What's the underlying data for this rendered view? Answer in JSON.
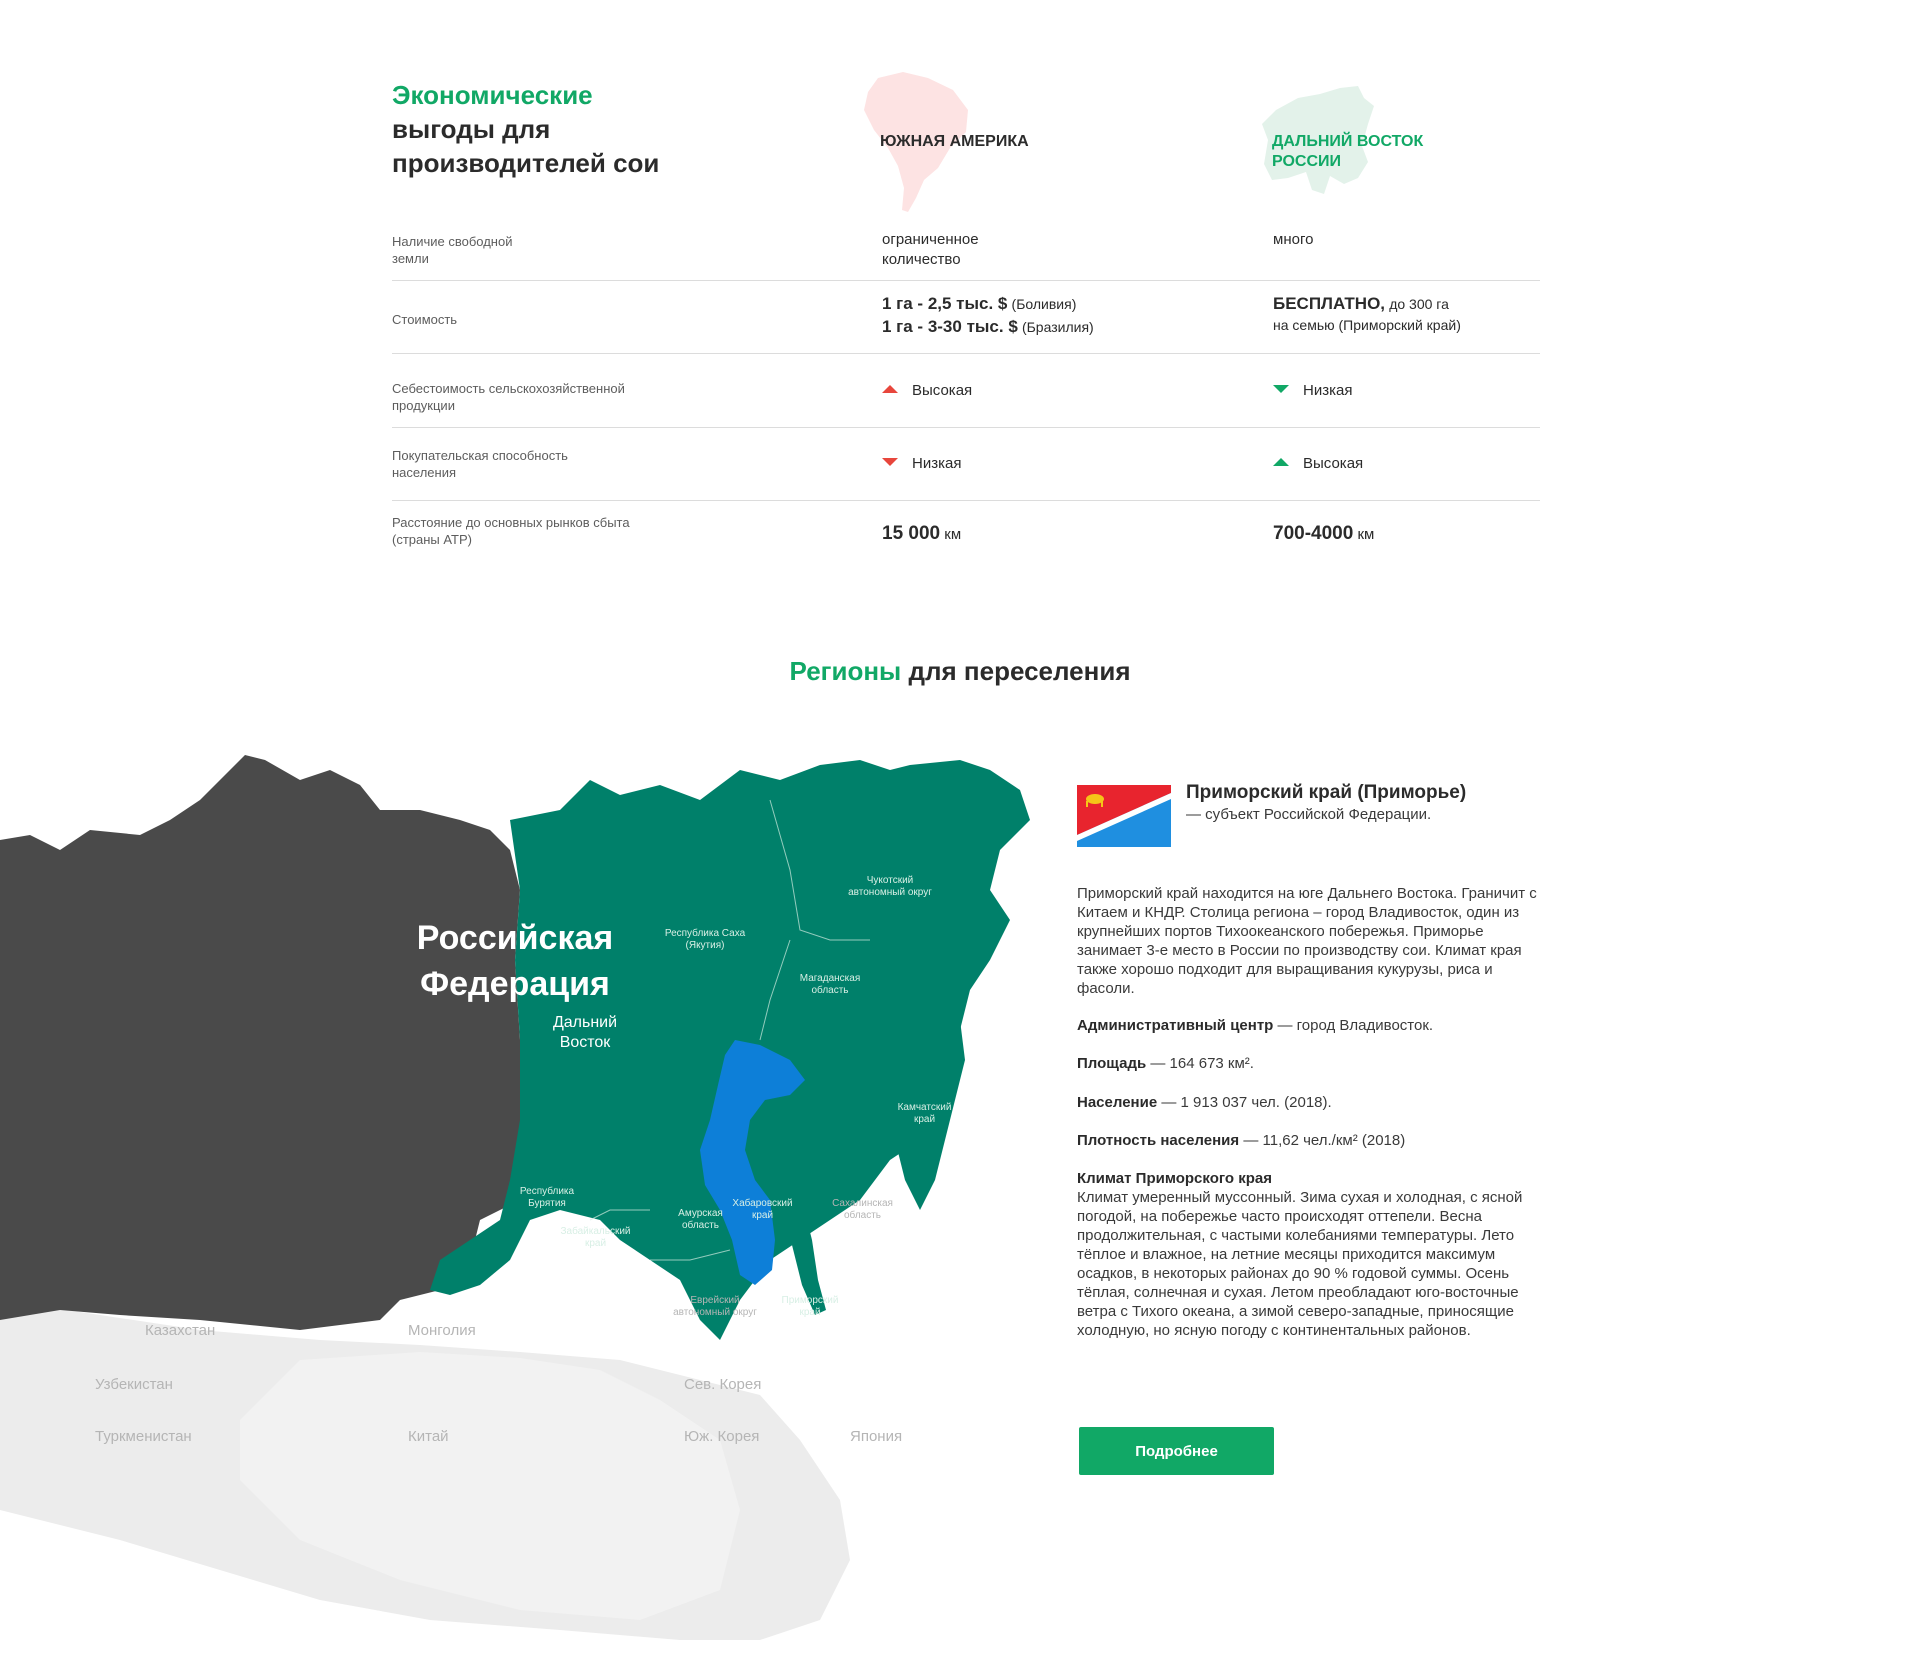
{
  "comparison": {
    "title_green": "Экономические",
    "title_rest": "выгоды для производителей сои",
    "col_south_america": "ЮЖНАЯ АМЕРИКА",
    "col_far_east": "ДАЛЬНИЙ ВОСТОК РОССИИ",
    "colors": {
      "accent_green": "#11a866",
      "red": "#e8463c",
      "sa_blob": "#fde3e3",
      "fe_blob": "#e3f2ea"
    },
    "rows": [
      {
        "label": "Наличие свободной земли",
        "sa": "ограниченное количество",
        "fe": "много"
      },
      {
        "label": "Стоимость",
        "sa_line1_bold": "1 га - 2,5 тыс. $",
        "sa_line1_note": "(Боливия)",
        "sa_line2_bold": "1 га - 3-30 тыс. $",
        "sa_line2_note": "(Бразилия)",
        "fe_bold": "БЕСПЛАТНО,",
        "fe_note1": "до 300 га",
        "fe_note2": "на семью (Приморский край)"
      },
      {
        "label": "Себестоимость сельскохозяйственной продукции",
        "sa": "Высокая",
        "sa_icon": "triangle-up-red-icon",
        "fe": "Низкая",
        "fe_icon": "triangle-down-green-icon"
      },
      {
        "label": "Покупательская способность населения",
        "sa": "Низкая",
        "sa_icon": "triangle-down-red-icon",
        "fe": "Высокая",
        "fe_icon": "triangle-up-green-icon"
      },
      {
        "label": "Расстояние до основных рынков сбыта (страны АТР)",
        "sa_value": "15 000",
        "sa_unit": "км",
        "fe_value": "700-4000",
        "fe_unit": "км"
      }
    ]
  },
  "regions": {
    "title_green": "Регионы",
    "title_rest": "для переселения",
    "map": {
      "russia_label_1": "Российская",
      "russia_label_2": "Федерация",
      "far_east_label_1": "Дальний",
      "far_east_label_2": "Восток",
      "region_labels": {
        "sakha": [
          "Республика Саха",
          "(Якутия)"
        ],
        "chukotka": [
          "Чукотский",
          "автономный округ"
        ],
        "magadan": [
          "Магаданская",
          "область"
        ],
        "kamchatka": [
          "Камчатский",
          "край"
        ],
        "buryatia": [
          "Республика",
          "Бурятия"
        ],
        "zabaikalsky": [
          "Забайкальский",
          "край"
        ],
        "amur": [
          "Амурская",
          "область"
        ],
        "khabarovsk": [
          "Хабаровский",
          "край"
        ],
        "sakhalin": [
          "Сахалинская",
          "область"
        ],
        "jewish": [
          "Еврейский",
          "автономный округ"
        ],
        "primorsky": [
          "Приморский",
          "край"
        ]
      },
      "countries": [
        "Казахстан",
        "Монголия",
        "Узбекистан",
        "Туркменистан",
        "Китай",
        "Сев. Корея",
        "Юж. Корея",
        "Япония"
      ],
      "colors": {
        "russia": "#4a4a4a",
        "far_east": "#00806a",
        "selected": "#0d7fd8",
        "neighbors": "#e6e6e6"
      }
    },
    "info": {
      "name_bold": "Приморский край (Приморье)",
      "name_rest": "— субъект Российской Федерации.",
      "description": "Приморский край находится на юге Дальнего Востока. Граничит с Китаем и КНДР. Столица региона – город Владивосток, один из крупнейших портов Тихоокеанского побережья. Приморье занимает 3-е место в России по производству сои. Климат края также хорошо подходит для выращивания кукурузы, риса и фасоли.",
      "admin_label": "Административный центр",
      "admin_value": "— город Владивосток.",
      "area_label": "Площадь",
      "area_value": "— 164 673 км².",
      "population_label": "Население",
      "population_value": "— 1 913 037 чел. (2018).",
      "density_label": "Плотность населения",
      "density_value": "— 11,62 чел./км² (2018)",
      "climate_title": "Климат Приморского края",
      "climate_text": "Климат умеренный муссонный. Зима сухая и холодная, с ясной погодой, на побережье часто происходят оттепели. Весна продолжительная, с частыми колебаниями температуры. Лето тёплое и влажное, на летние месяцы приходится максимум осадков, в некоторых районах до 90 % годовой суммы. Осень тёплая, солнечная и сухая. Летом преобладают юго-восточные ветра с Тихого океана, а зимой северо-западные, приносящие холодную, но ясную погоду с континентальных районов.",
      "button_label": "Подробнее"
    }
  }
}
